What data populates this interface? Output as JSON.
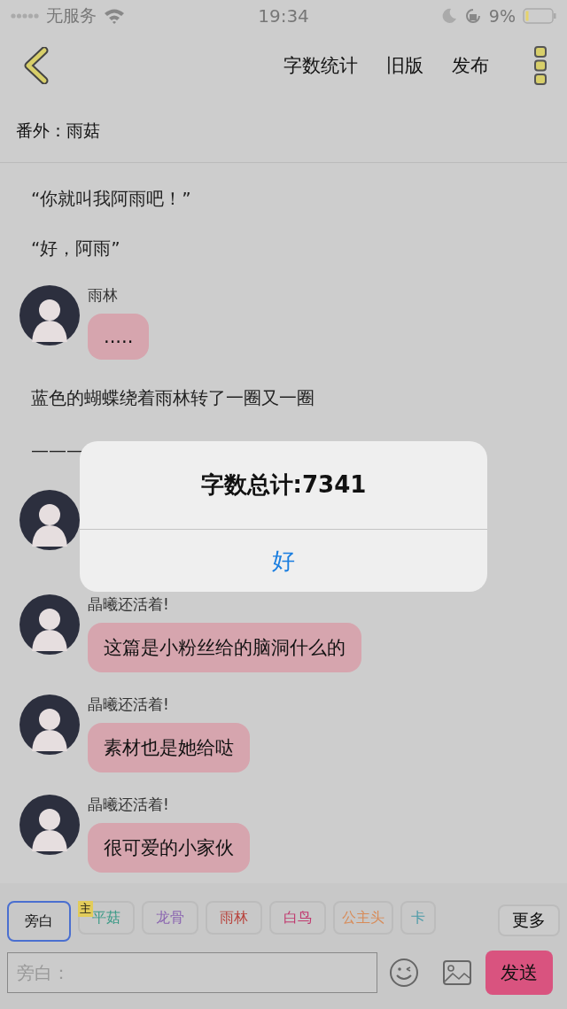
{
  "status_bar": {
    "carrier": "无服务",
    "time": "19:34",
    "battery": "9%"
  },
  "nav": {
    "actions": [
      "字数统计",
      "旧版",
      "发布"
    ]
  },
  "chapter_title": "番外：雨菇",
  "messages": [
    {
      "kind": "narration",
      "text": "“你就叫我阿雨吧！”"
    },
    {
      "kind": "narration",
      "text": "“好，阿雨”"
    },
    {
      "kind": "message",
      "name": "雨林",
      "text": "....."
    },
    {
      "kind": "narration",
      "text": "蓝色的蝴蝶绕着雨林转了一圈又一圈"
    },
    {
      "kind": "rule",
      "text": "———"
    },
    {
      "kind": "message"
    },
    {
      "kind": "message",
      "name": "晶曦还活着!",
      "text": "这篇是小粉丝给的脑洞什么的"
    },
    {
      "kind": "message",
      "name": "晶曦还活着!",
      "text": "素材也是她给哒"
    },
    {
      "kind": "message",
      "name": "晶曦还活着!",
      "text": "很可爱的小家伙"
    }
  ],
  "dialog": {
    "message": "字数总计:7341",
    "button": "好"
  },
  "roles": [
    {
      "label": "旁白",
      "color": "#111111",
      "selected": true
    },
    {
      "label": "平菇",
      "color": "#3a9a86",
      "selected": false,
      "badge": "主"
    },
    {
      "label": "龙骨",
      "color": "#8a64b0",
      "selected": false
    },
    {
      "label": "雨林",
      "color": "#b8433c",
      "selected": false
    },
    {
      "label": "白鸟",
      "color": "#c0386e",
      "selected": false
    },
    {
      "label": "公主头",
      "color": "#d88a56",
      "selected": false
    },
    {
      "label": "卡",
      "color": "#4a9aa8",
      "selected": false
    }
  ],
  "more_button": "更多",
  "input": {
    "placeholder": "旁白："
  },
  "send_button": "发送"
}
